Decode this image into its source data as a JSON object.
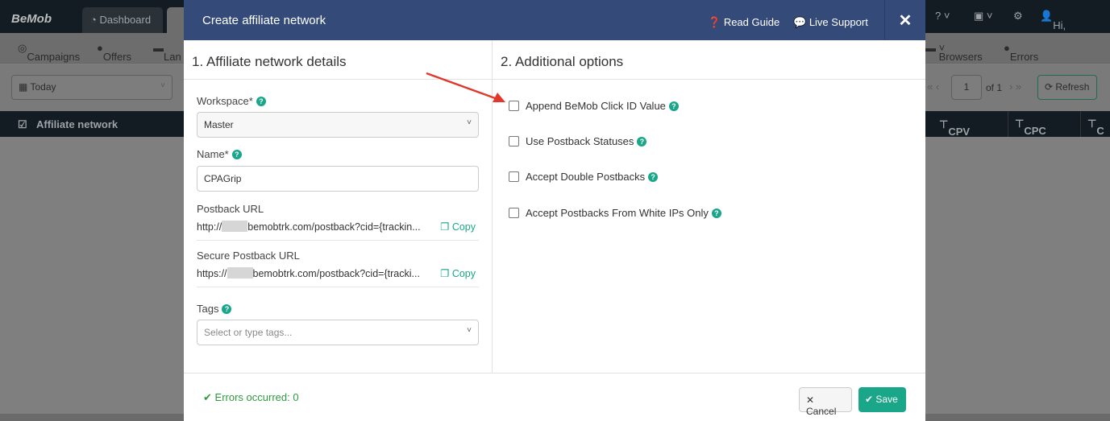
{
  "app": {
    "logo": "BeMob",
    "tabs": [
      "Dashboard"
    ],
    "user": "Hi, BeMob"
  },
  "subnav": {
    "items": [
      "Campaigns",
      "Offers",
      "Lan",
      "Browsers",
      "Errors"
    ]
  },
  "filters": {
    "date": "Today",
    "page": "1",
    "of": "of 1",
    "refresh": "Refresh"
  },
  "table": {
    "headers": [
      "Affiliate network",
      "CPV",
      "CPC",
      "C"
    ]
  },
  "modal": {
    "title": "Create affiliate network",
    "read_guide": "Read Guide",
    "live_support": "Live Support",
    "close": "✕",
    "section1": "1. Affiliate network details",
    "section2": "2. Additional options",
    "workspace_label": "Workspace*",
    "workspace_value": "Master",
    "name_label": "Name*",
    "name_value": "CPAGrip",
    "postback_label": "Postback URL",
    "postback_prefix": "http://",
    "postback_rest": "bemobtrk.com/postback?cid={trackin...",
    "secure_label": "Secure Postback URL",
    "secure_prefix": "https://",
    "secure_rest": "bemobtrk.com/postback?cid={tracki...",
    "copy": "Copy",
    "tags_label": "Tags",
    "tags_placeholder": "Select or type tags...",
    "options": [
      {
        "label": "Append BeMob Click ID Value",
        "checked": false
      },
      {
        "label": "Use Postback Statuses",
        "checked": false
      },
      {
        "label": "Accept Double Postbacks",
        "checked": false
      },
      {
        "label": "Accept Postbacks From White IPs Only",
        "checked": false
      }
    ],
    "errors": "Errors occurred: 0",
    "cancel": "Cancel",
    "save": "Save"
  },
  "colors": {
    "accent": "#1aa689",
    "header": "#344a78",
    "arrow": "#e0392b",
    "success": "#2e9a3c"
  }
}
